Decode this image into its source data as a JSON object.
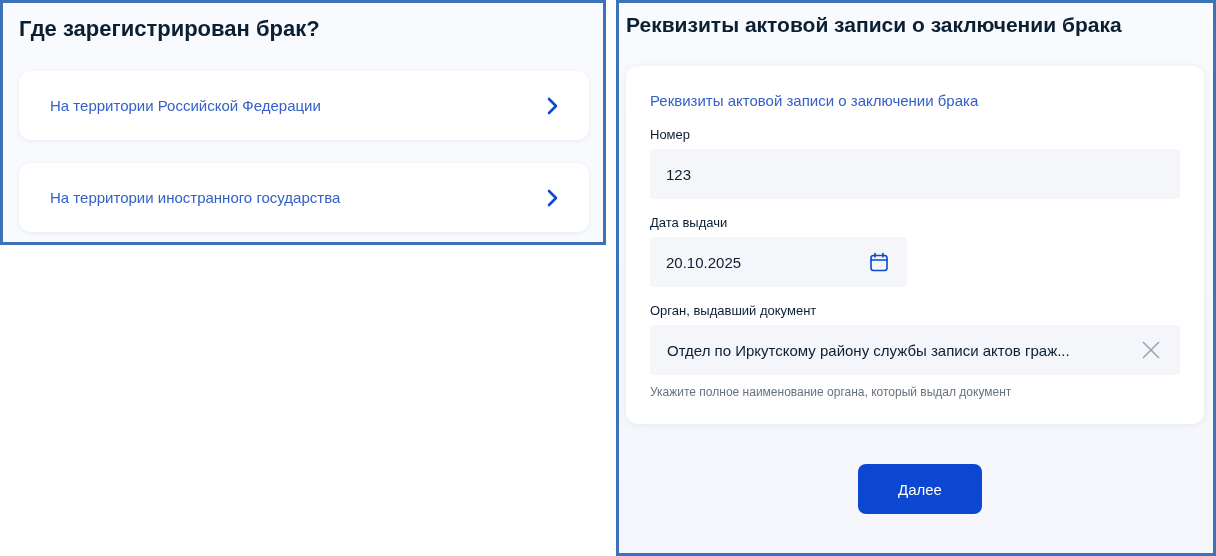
{
  "left_panel": {
    "title": "Где зарегистрирован брак?",
    "options": [
      {
        "label": "На территории Российской Федерации"
      },
      {
        "label": "На территории иностранного государства"
      }
    ]
  },
  "right_panel": {
    "title": "Реквизиты актовой записи о заключении брака",
    "card": {
      "heading": "Реквизиты актовой записи о заключении брака",
      "fields": [
        {
          "kind": "text",
          "label": "Номер",
          "value": "123"
        },
        {
          "kind": "date",
          "label": "Дата выдачи",
          "value": "20.10.2025"
        },
        {
          "kind": "clearable",
          "label": "Орган, выдавший документ",
          "value": "Отдел по Иркутскому району службы записи актов граж...",
          "hint": "Укажите полное наименование органа, который выдал документ"
        }
      ]
    },
    "button": "Далее"
  }
}
